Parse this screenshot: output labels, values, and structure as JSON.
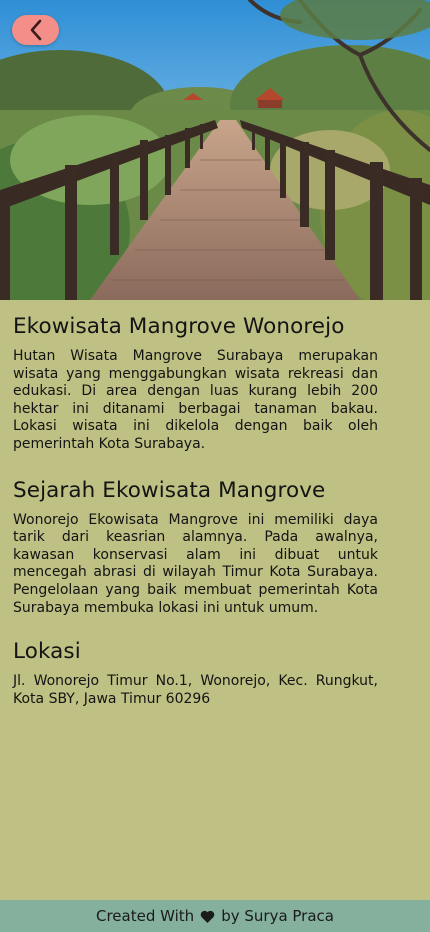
{
  "header": {
    "back_icon": "chevron-left-icon",
    "back_button_color": "#f38f88",
    "hero_image": "mangrove-boardwalk-photo"
  },
  "sections": [
    {
      "title": "Ekowisata Mangrove Wonorejo",
      "body": "Hutan Wisata Mangrove Surabaya merupakan wisata yang menggabungkan wisata rekreasi dan edukasi. Di area dengan luas kurang lebih 200 hektar ini ditanami berbagai tanaman bakau. Lokasi wisata ini dikelola dengan baik oleh pemerintah Kota Surabaya."
    },
    {
      "title": "Sejarah Ekowisata Mangrove",
      "body": "Wonorejo Ekowisata Mangrove ini memiliki daya tarik dari keasrian alamnya. Pada awalnya, kawasan konservasi alam ini dibuat untuk mencegah abrasi di wilayah Timur Kota Surabaya. Pengelolaan yang baik membuat pemerintah Kota Surabaya membuka lokasi ini untuk umum."
    },
    {
      "title": "Lokasi",
      "body": "Jl. Wonorejo Timur No.1, Wonorejo, Kec. Rungkut, Kota SBY, Jawa Timur 60296"
    }
  ],
  "footer": {
    "prefix": "Created With",
    "icon": "heart-icon",
    "suffix": "by Surya Praca"
  },
  "colors": {
    "background": "#bfc083",
    "footer": "#84b09d",
    "text": "#141414"
  }
}
